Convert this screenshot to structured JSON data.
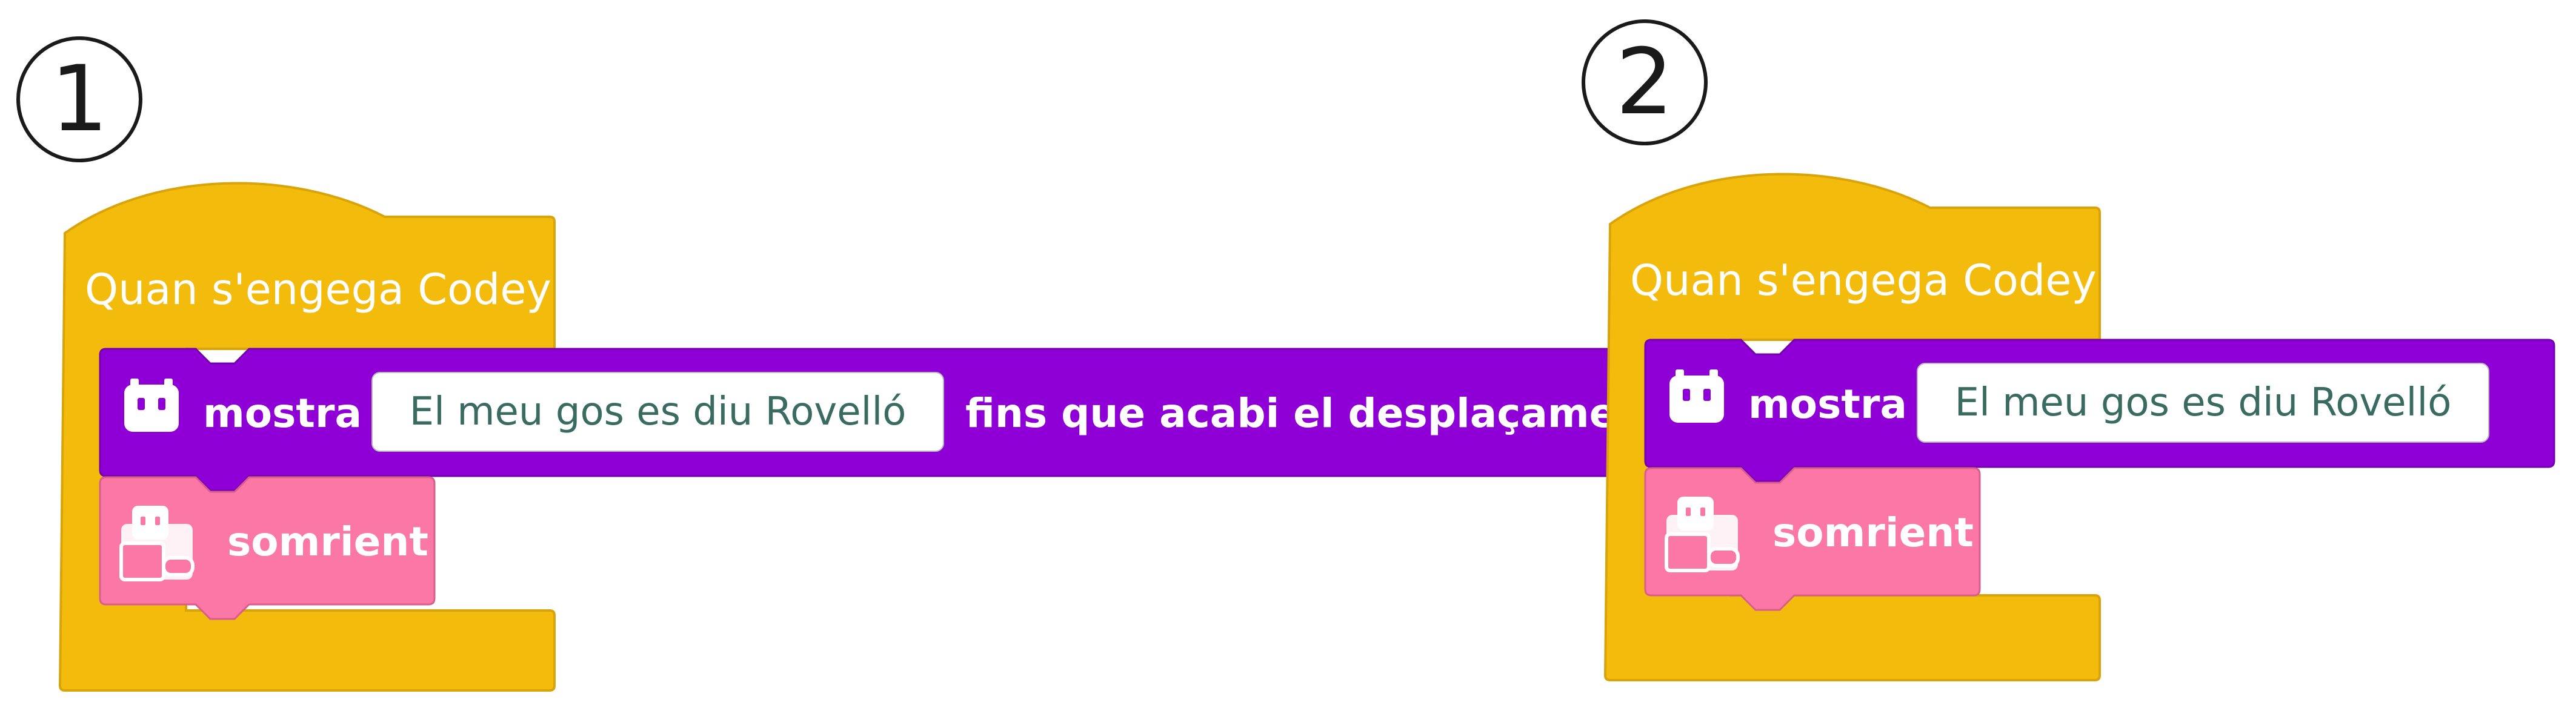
{
  "panels": [
    {
      "step": "1",
      "hat_label": "Quan s'engega Codey",
      "display_block": {
        "icon": "codey-face-icon",
        "label": "mostra",
        "text_value": "El meu gos es diu Rovelló",
        "suffix": "fins que acabi el desplaçament"
      },
      "face_block": {
        "icon": "codey-rocky-icon",
        "label": "somrient"
      }
    },
    {
      "step": "2",
      "hat_label": "Quan s'engega Codey",
      "display_block": {
        "icon": "codey-face-icon",
        "label": "mostra",
        "text_value": "El meu gos es diu Rovelló"
      },
      "face_block": {
        "icon": "codey-rocky-icon",
        "label": "somrient"
      }
    }
  ],
  "colors": {
    "event_block": "#F3BC0C",
    "event_block_border": "#D9A40A",
    "display_block": "#8E00D6",
    "display_block_border": "#7400B0",
    "face_block": "#FB77A6",
    "face_block_border": "#D95E8B",
    "text_field_value": "#3A6B60"
  }
}
